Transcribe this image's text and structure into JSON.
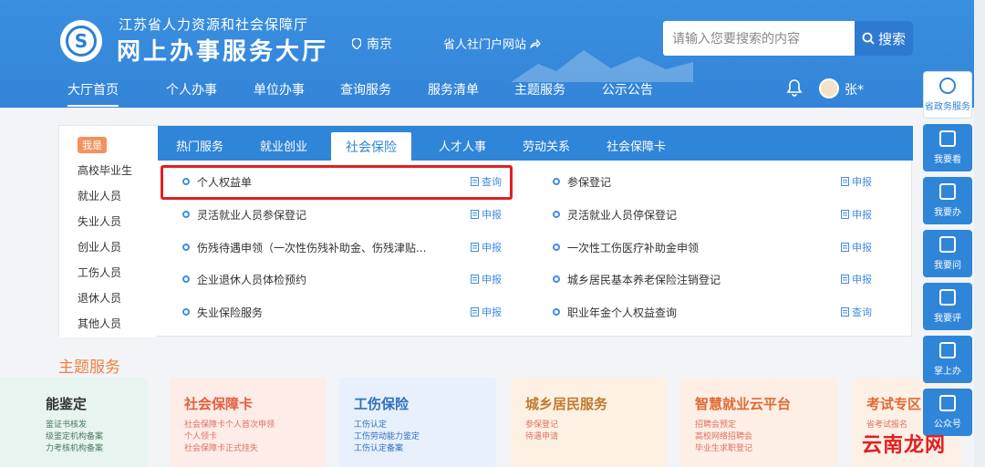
{
  "header": {
    "org": "江苏省人力资源和社会保障厅",
    "title": "网上办事服务大厅",
    "location": "南京",
    "portal": "省人社门户网站",
    "search_placeholder": "请输入您要搜索的内容",
    "search_button": "搜索",
    "user": "张*"
  },
  "nav": [
    "大厅首页",
    "个人办事",
    "单位办事",
    "查询服务",
    "服务清单",
    "主题服务",
    "公示公告"
  ],
  "side": {
    "tag": "我是",
    "items": [
      "高校毕业生",
      "就业人员",
      "失业人员",
      "创业人员",
      "工伤人员",
      "退休人员",
      "其他人员"
    ]
  },
  "tabs": [
    "热门服务",
    "就业创业",
    "社会保险",
    "人才人事",
    "劳动关系",
    "社会保障卡"
  ],
  "services_left": [
    {
      "name": "个人权益单",
      "action": "查询"
    },
    {
      "name": "灵活就业人员参保登记",
      "action": "申报"
    },
    {
      "name": "伤残待遇申领（一次性伤残补助金、伤残津贴...",
      "action": "申报"
    },
    {
      "name": "企业退休人员体检预约",
      "action": "申报"
    },
    {
      "name": "失业保险服务",
      "action": "申报"
    }
  ],
  "services_right": [
    {
      "name": "参保登记",
      "action": "申报"
    },
    {
      "name": "灵活就业人员停保登记",
      "action": "申报"
    },
    {
      "name": "一次性工伤医疗补助金申领",
      "action": "申报"
    },
    {
      "name": "城乡居民基本养老保险注销登记",
      "action": "申报"
    },
    {
      "name": "职业年金个人权益查询",
      "action": "查询"
    }
  ],
  "theme": {
    "title": "主题服务",
    "cards": [
      {
        "title": "能鉴定",
        "lines": [
          "鉴证书核发",
          "级鉴定机构备案",
          "力考核机构备案"
        ],
        "color": "#e8f4ef",
        "text": "#333"
      },
      {
        "title": "社会保障卡",
        "lines": [
          "社会保障卡个人首次申领",
          "个人领卡",
          "社会保障卡正式挂失"
        ],
        "color": "#fdece7",
        "text": "#e06040"
      },
      {
        "title": "工伤保险",
        "lines": [
          "工伤认定",
          "工伤劳动能力鉴定",
          "工伤认定备案"
        ],
        "color": "#e7f0fb",
        "text": "#2f6fc0"
      },
      {
        "title": "城乡居民服务",
        "lines": [
          "参保登记",
          "待遇申请"
        ],
        "color": "#fdf1e4",
        "text": "#c07a30"
      },
      {
        "title": "智慧就业云平台",
        "lines": [
          "招聘会预定",
          "高校网络招聘会",
          "毕业生求职登记"
        ],
        "color": "#fdeee6",
        "text": "#e06a30"
      },
      {
        "title": "考试专区",
        "lines": [
          "省考试报名",
          "..."
        ],
        "color": "#fdf0e7",
        "text": "#e06a30"
      }
    ]
  },
  "rail": [
    "省政务服务",
    "我要看",
    "我要办",
    "我要问",
    "我要评",
    "掌上办",
    "公众号"
  ],
  "watermark": "云南龙网"
}
